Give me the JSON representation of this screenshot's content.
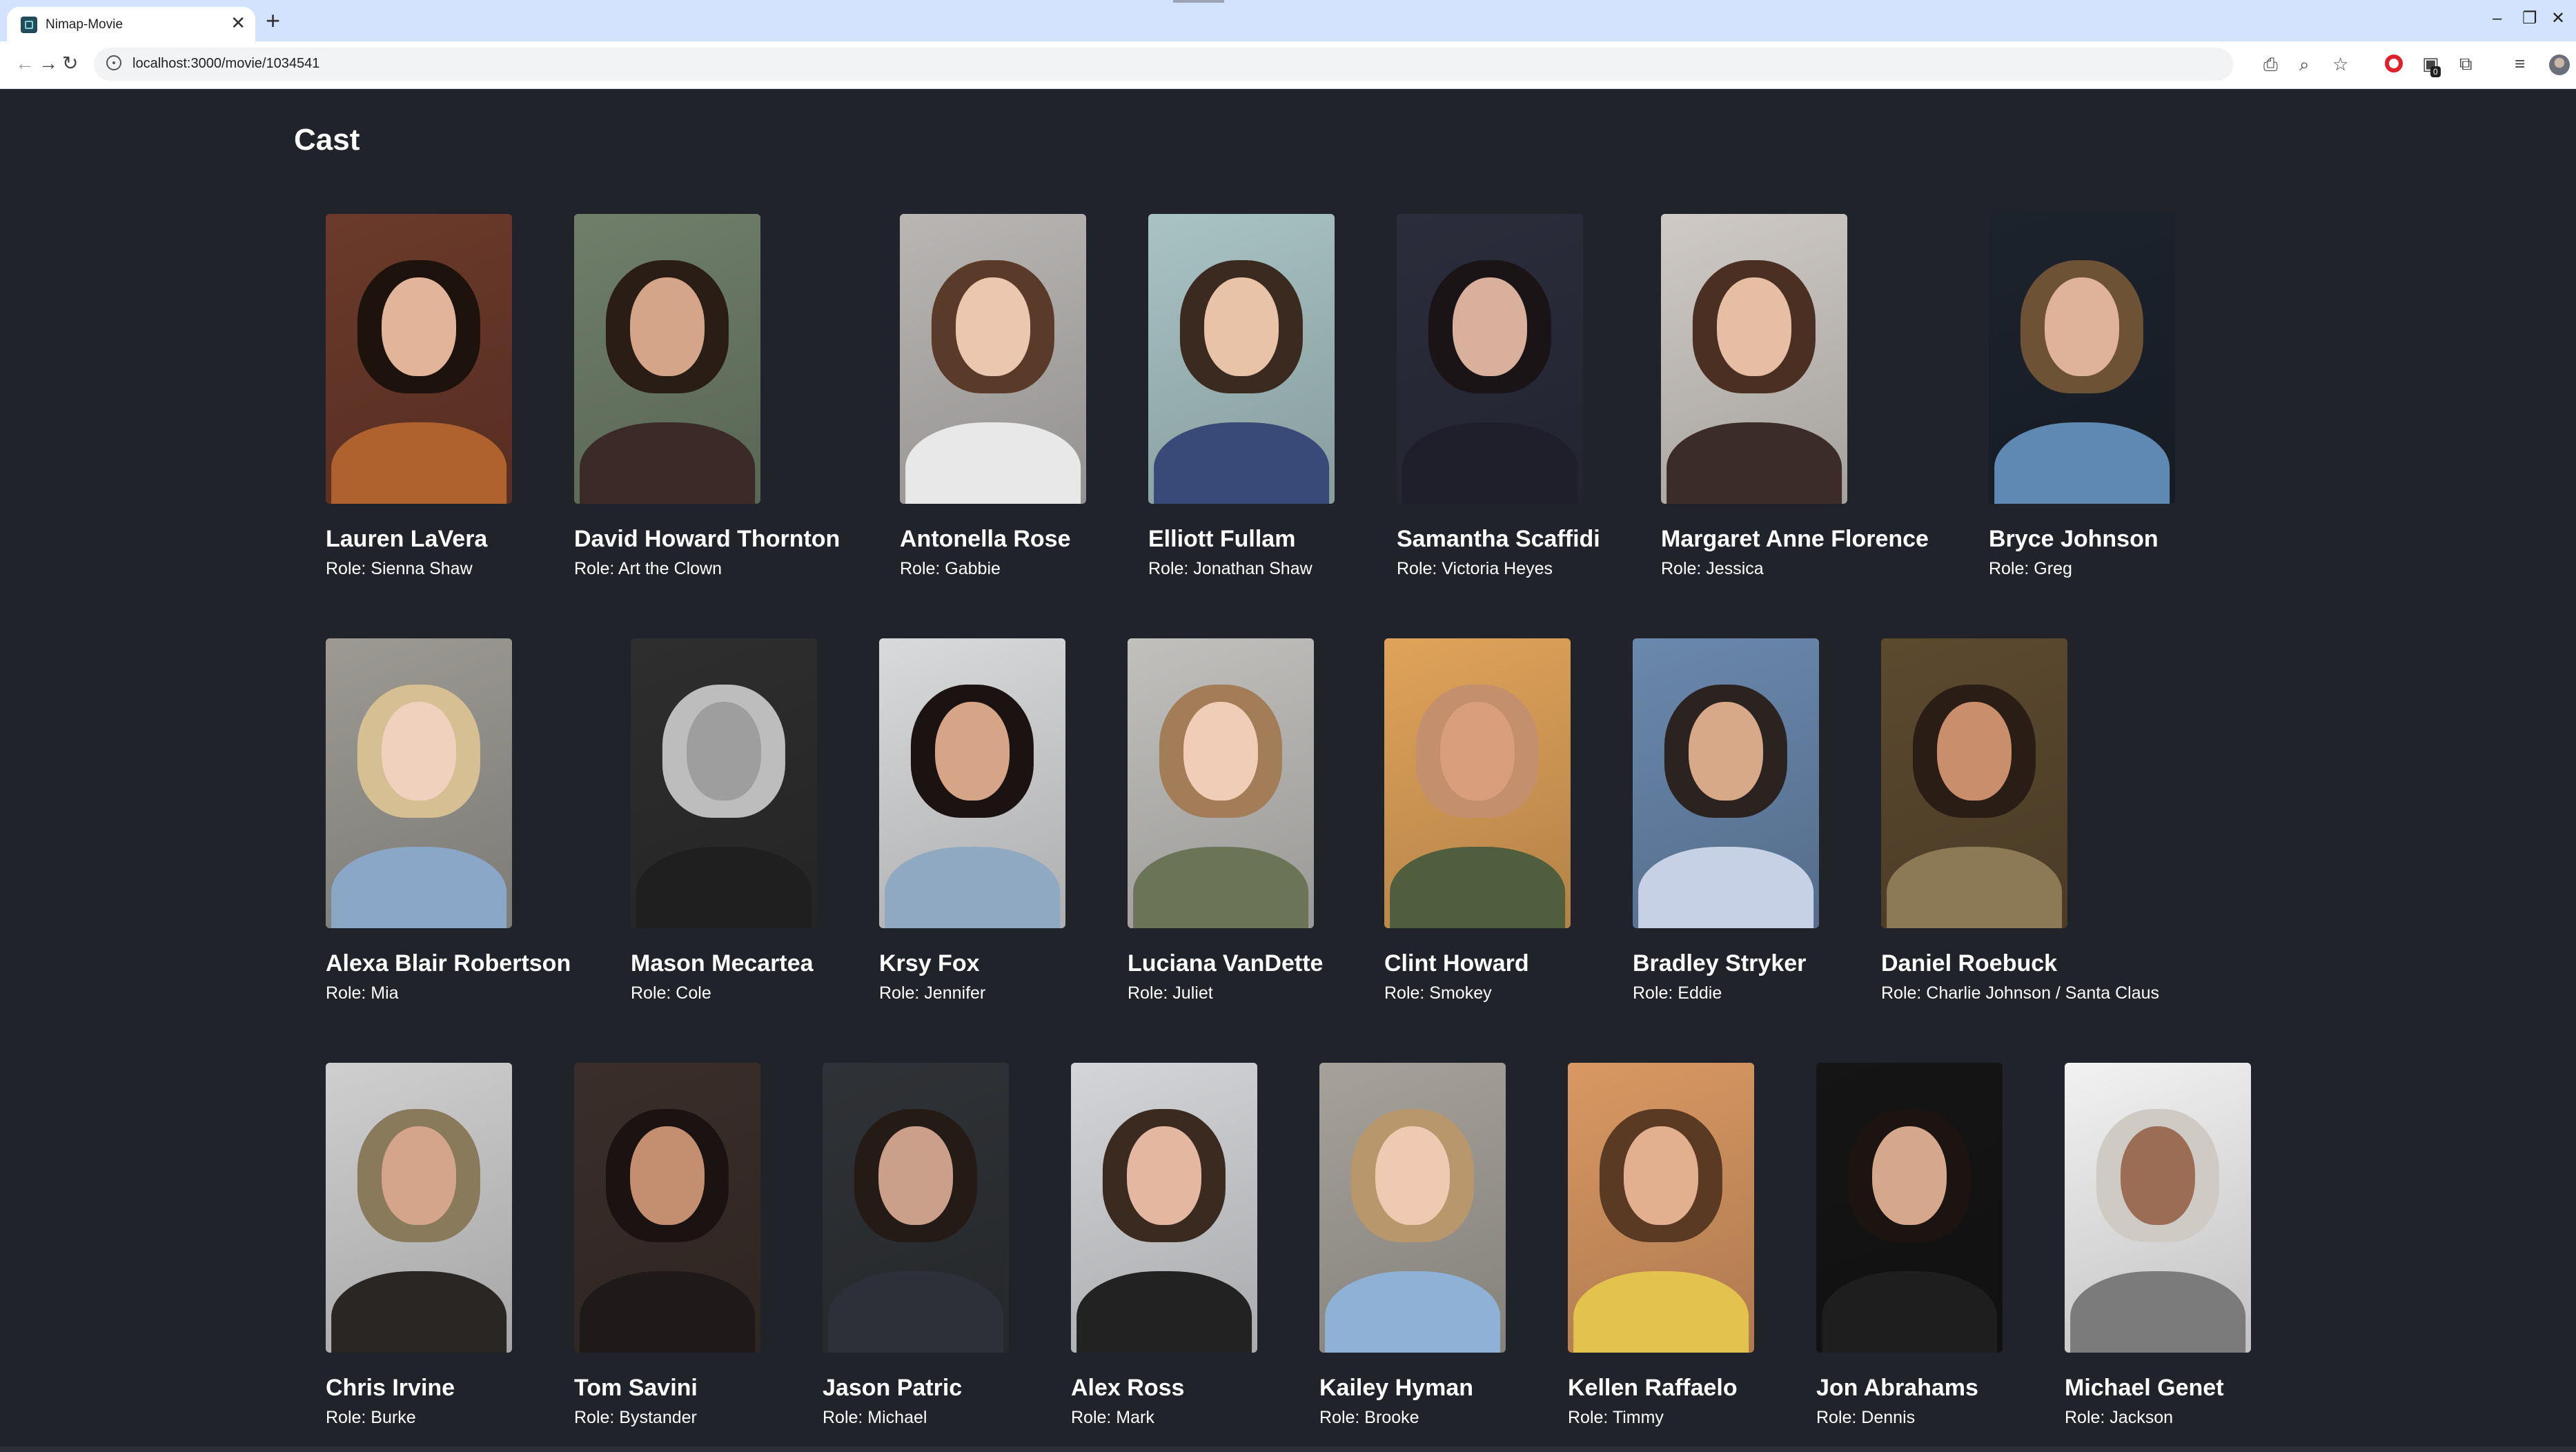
{
  "browser": {
    "tab_title": "Nimap-Movie",
    "tab_close": "✕",
    "new_tab": "+",
    "url": "localhost:3000/movie/1034541",
    "window": {
      "minimize": "–",
      "restore": "❐",
      "close": "✕"
    },
    "nav": {
      "back": "←",
      "forward": "→",
      "reload": "↻"
    }
  },
  "page": {
    "heading": "Cast",
    "cast": [
      {
        "name": "Lauren LaVera",
        "role": "Role: Sienna Shaw",
        "bg": "#6b3a2a",
        "hair": "#1e120d",
        "skin": "#e2b49a",
        "shirt": "#b0622e"
      },
      {
        "name": "David Howard Thornton",
        "role": "Role: Art the Clown",
        "bg": "#6f7f6a",
        "hair": "#2a1d16",
        "skin": "#d5a58a",
        "shirt": "#3b2a25"
      },
      {
        "name": "Antonella Rose",
        "role": "Role: Gabbie",
        "bg": "#b9b6b4",
        "hair": "#5a3a28",
        "skin": "#ecc7b0",
        "shirt": "#e8e8e8"
      },
      {
        "name": "Elliott Fullam",
        "role": "Role: Jonathan Shaw",
        "bg": "#a9c3c4",
        "hair": "#3b2a1f",
        "skin": "#e9c3a8",
        "shirt": "#3a4a78"
      },
      {
        "name": "Samantha Scaffidi",
        "role": "Role: Victoria Heyes",
        "bg": "#2b2d3c",
        "hair": "#1a1416",
        "skin": "#d8b09b",
        "shirt": "#1e1f2a"
      },
      {
        "name": "Margaret Anne Florence",
        "role": "Role: Jessica",
        "bg": "#cfcac5",
        "hair": "#4b2f22",
        "skin": "#e6bea4",
        "shirt": "#3c2c28"
      },
      {
        "name": "Bryce Johnson",
        "role": "Role: Greg",
        "bg": "#1c232d",
        "hair": "#6e5236",
        "skin": "#dfb39a",
        "shirt": "#5f89b2"
      },
      {
        "name": "Alexa Blair Robertson",
        "role": "Role: Mia",
        "bg": "#9c9a93",
        "hair": "#d7bf94",
        "skin": "#f0d1bd",
        "shirt": "#8aa7c8"
      },
      {
        "name": "Mason Mecartea",
        "role": "Role: Cole",
        "bg": "#2e2e2e",
        "hair": "#bdbdbd",
        "skin": "#9e9e9e",
        "shirt": "#1f1f1f"
      },
      {
        "name": "Krsy Fox",
        "role": "Role: Jennifer",
        "bg": "#d9dadb",
        "hair": "#1b1212",
        "skin": "#d6a487",
        "shirt": "#8fa9c2"
      },
      {
        "name": "Luciana VanDette",
        "role": "Role: Juliet",
        "bg": "#c1c0bd",
        "hair": "#a27d57",
        "skin": "#efcdb6",
        "shirt": "#6c7457"
      },
      {
        "name": "Clint Howard",
        "role": "Role: Smokey",
        "bg": "#e0a35a",
        "hair": "#c48f6c",
        "skin": "#d99e7c",
        "shirt": "#4f5e3d"
      },
      {
        "name": "Bradley Stryker",
        "role": "Role: Eddie",
        "bg": "#6a88ad",
        "hair": "#2a2320",
        "skin": "#d7a989",
        "shirt": "#c7d1e6"
      },
      {
        "name": "Daniel Roebuck",
        "role": "Role: Charlie Johnson / Santa Claus",
        "bg": "#5c4a2f",
        "hair": "#2a1d16",
        "skin": "#c98e6c",
        "shirt": "#8c7a56"
      },
      {
        "name": "Chris Irvine",
        "role": "Role: Burke",
        "bg": "#cfcfcf",
        "hair": "#8a7a5c",
        "skin": "#d4a48b",
        "shirt": "#2a2623"
      },
      {
        "name": "Tom Savini",
        "role": "Role: Bystander",
        "bg": "#3a2e2a",
        "hair": "#1a1312",
        "skin": "#c48e71",
        "shirt": "#1f1a19"
      },
      {
        "name": "Jason Patric",
        "role": "Role: Michael",
        "bg": "#2f3236",
        "hair": "#241b17",
        "skin": "#caa08a",
        "shirt": "#2d3038"
      },
      {
        "name": "Alex Ross",
        "role": "Role: Mark",
        "bg": "#d3d5d8",
        "hair": "#3a2a1f",
        "skin": "#e3b7a0",
        "shirt": "#222222"
      },
      {
        "name": "Kailey Hyman",
        "role": "Role: Brooke",
        "bg": "#a6a29a",
        "hair": "#b8976d",
        "skin": "#f0c9b2",
        "shirt": "#8fb1d5"
      },
      {
        "name": "Kellen Raffaelo",
        "role": "Role: Timmy",
        "bg": "#d99863",
        "hair": "#5a3a22",
        "skin": "#e2b08e",
        "shirt": "#e3c24d"
      },
      {
        "name": "Jon Abrahams",
        "role": "Role: Dennis",
        "bg": "#151515",
        "hair": "#1b1410",
        "skin": "#d5a78d",
        "shirt": "#1e1e1e"
      },
      {
        "name": "Michael Genet",
        "role": "Role: Jackson",
        "bg": "#f2f2f2",
        "hair": "#cfcac4",
        "skin": "#9b6d55",
        "shirt": "#7b7b7b"
      }
    ]
  }
}
